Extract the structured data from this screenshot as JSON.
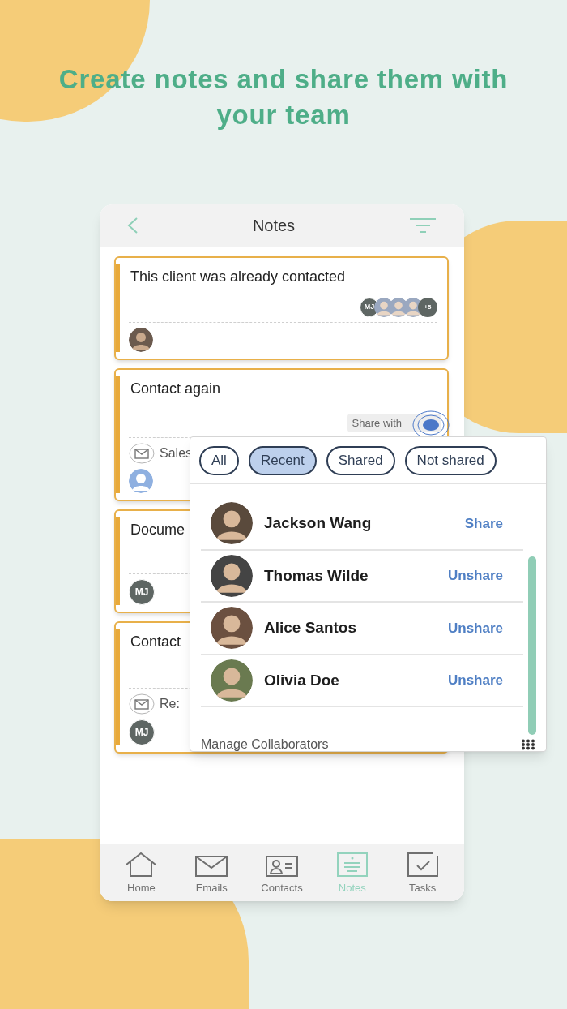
{
  "headline": "Create notes and share them with your team",
  "header": {
    "title": "Notes"
  },
  "notes": [
    {
      "title": "This client was already contacted",
      "collaborators": [
        {
          "kind": "initials",
          "text": "MJ"
        },
        {
          "kind": "photo"
        },
        {
          "kind": "photo"
        },
        {
          "kind": "photo"
        },
        {
          "kind": "more",
          "text": "+5"
        }
      ],
      "owner": {
        "kind": "photo"
      }
    },
    {
      "title": "Contact again",
      "share_label": "Share with",
      "email": "Sales",
      "owner": {
        "kind": "placeholder"
      }
    },
    {
      "title": "Docume",
      "owner": {
        "kind": "initials",
        "text": "MJ"
      }
    },
    {
      "title": "Contact",
      "email": "Re:",
      "owner": {
        "kind": "initials",
        "text": "MJ"
      }
    }
  ],
  "share_popup": {
    "filters": [
      {
        "label": "All",
        "selected": false
      },
      {
        "label": "Recent",
        "selected": true
      },
      {
        "label": "Shared",
        "selected": false
      },
      {
        "label": "Not shared",
        "selected": false
      }
    ],
    "people": [
      {
        "name": "Jackson Wang",
        "action": "Share"
      },
      {
        "name": "Thomas Wilde",
        "action": "Unshare"
      },
      {
        "name": "Alice Santos",
        "action": "Unshare"
      },
      {
        "name": "Olivia Doe",
        "action": "Unshare"
      }
    ],
    "footer": "Manage Collaborators"
  },
  "nav": [
    {
      "kind": "home",
      "label": "Home",
      "selected": false
    },
    {
      "kind": "emails",
      "label": "Emails",
      "selected": false
    },
    {
      "kind": "contacts",
      "label": "Contacts",
      "selected": false
    },
    {
      "kind": "notes",
      "label": "Notes",
      "selected": true
    },
    {
      "kind": "tasks",
      "label": "Tasks",
      "selected": false
    }
  ]
}
